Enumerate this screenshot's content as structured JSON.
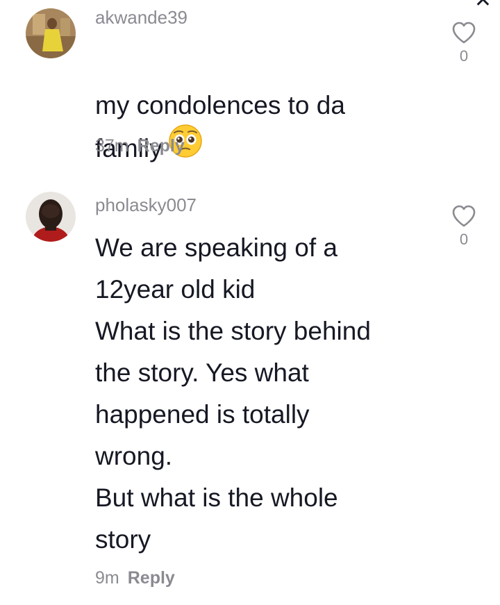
{
  "close_icon": "close-icon",
  "comments": [
    {
      "username": "akwande39",
      "text": "my condolences to da\nfamily",
      "emoji": "pleading-face-emoji",
      "time": "37m",
      "reply_label": "Reply",
      "likes": "0"
    },
    {
      "username": "pholasky007",
      "text": "We are speaking of a\n12year old kid\nWhat is the story behind\nthe story. Yes what\nhappened is totally\nwrong.\nBut what is the whole\nstory",
      "time": "9m",
      "reply_label": "Reply",
      "likes": "0"
    }
  ],
  "colors": {
    "text": "#161823",
    "secondary": "#8a8b91"
  }
}
